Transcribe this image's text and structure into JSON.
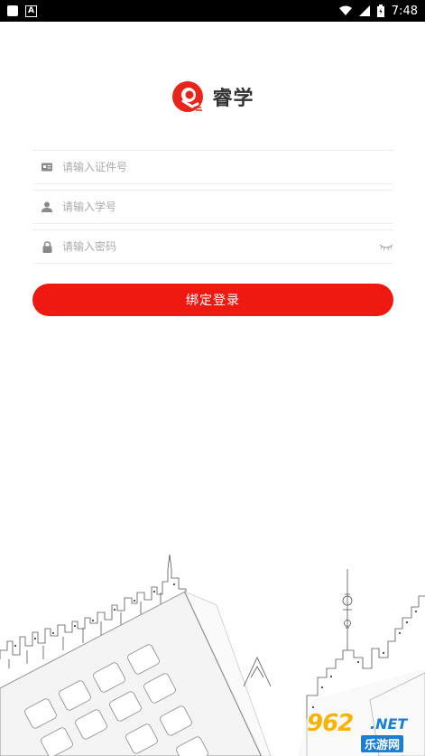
{
  "status_bar": {
    "time": "7:48",
    "icons": [
      "notification-square-icon",
      "text-a-icon",
      "wifi-icon",
      "signal-icon",
      "battery-icon"
    ]
  },
  "app": {
    "name": "睿学",
    "brand_color": "#ee1a12"
  },
  "form": {
    "id_field": {
      "placeholder": "请输入证件号",
      "value": "",
      "icon": "id-card-icon"
    },
    "student_field": {
      "placeholder": "请输入学号",
      "value": "",
      "icon": "user-icon"
    },
    "password_field": {
      "placeholder": "请输入密码",
      "value": "",
      "icon": "lock-icon",
      "toggle_icon": "eye-closed-icon"
    },
    "submit_label": "绑定登录"
  },
  "watermark": {
    "number": "962",
    "suffix": ".NET",
    "site": "乐游网"
  }
}
